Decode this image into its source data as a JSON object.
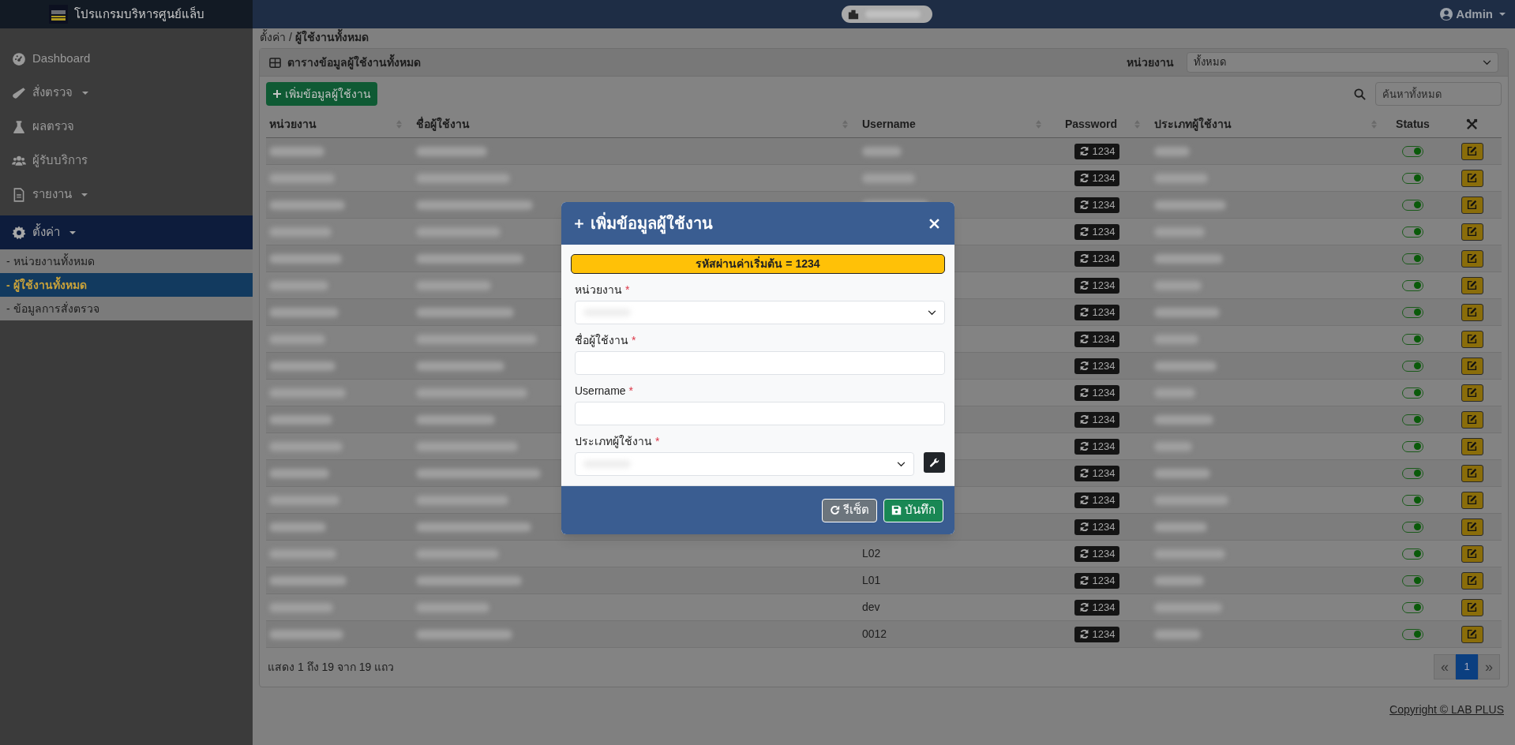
{
  "app": {
    "title": "โปรแกรมบริหารศูนย์แล็บ",
    "user": "Admin"
  },
  "sidebar": {
    "items": [
      {
        "label": "Dashboard",
        "selected": false,
        "dropdown": false
      },
      {
        "label": "สั่งตรวจ",
        "selected": false,
        "dropdown": true
      },
      {
        "label": "ผลตรวจ",
        "selected": false,
        "dropdown": false
      },
      {
        "label": "ผู้รับบริการ",
        "selected": false,
        "dropdown": false
      },
      {
        "label": "รายงาน",
        "selected": false,
        "dropdown": true
      },
      {
        "label": "ตั้งค่า",
        "selected": true,
        "dropdown": true,
        "children": [
          {
            "label": "- หน่วยงานทั้งหมด",
            "selected": false
          },
          {
            "label": "- ผู้ใช้งานทั้งหมด",
            "selected": true
          },
          {
            "label": "- ข้อมูลการสั่งตรวจ",
            "selected": false
          }
        ]
      }
    ]
  },
  "breadcrumb": [
    "ตั้งค่า /",
    "ผู้ใช้งานทั้งหมด"
  ],
  "card": {
    "title": "ตารางข้อมูลผู้ใช้งานทั้งหมด",
    "filter_label": "หน่วยงาน",
    "filter_value": "ทั้งหมด",
    "add_button": "เพิ่มข้อมูลผู้ใช้งาน",
    "search": {
      "placeholder": "ค้นหาทั้งหมด"
    }
  },
  "table": {
    "columns": [
      "หน่วยงาน",
      "ชื่อผู้ใช้งาน",
      "Username",
      "Password",
      "ประเภทผู้ใช้งาน",
      "Status"
    ],
    "rows": [
      {
        "password": "1234",
        "on": true
      },
      {
        "password": "1234",
        "on": true
      },
      {
        "password": "1234",
        "on": true
      },
      {
        "password": "1234",
        "on": true
      },
      {
        "password": "1234",
        "on": true
      },
      {
        "password": "1234",
        "on": true
      },
      {
        "password": "1234",
        "on": true
      },
      {
        "password": "1234",
        "on": true
      },
      {
        "password": "1234",
        "on": true
      },
      {
        "password": "1234",
        "on": true
      },
      {
        "password": "1234",
        "on": true
      },
      {
        "password": "1234",
        "on": true
      },
      {
        "password": "1234",
        "on": true
      },
      {
        "password": "1234",
        "on": true
      },
      {
        "password": "1234",
        "on": true
      },
      {
        "username": "L02",
        "password": "1234",
        "on": true
      },
      {
        "username": "L01",
        "password": "1234",
        "on": true
      },
      {
        "username": "dev",
        "password": "1234",
        "on": true
      },
      {
        "username": "0012",
        "password": "1234",
        "on": true
      }
    ]
  },
  "table_info": "แสดง 1 ถึง 19 จาก 19 แถว",
  "pagination": {
    "first": "«",
    "pages": [
      {
        "label": "1",
        "selected": true
      }
    ],
    "last": "»"
  },
  "footer": "Copyright © LAB PLUS",
  "modal": {
    "title": "เพิ่มข้อมูลผู้ใช้งาน",
    "alert": "รหัสผ่านค่าเริ่มต้น = 1234",
    "fields": [
      {
        "label": "หน่วยงาน",
        "kind": "select",
        "required_mark": "*"
      },
      {
        "label": "ชื่อผู้ใช้งาน",
        "kind": "text",
        "required_mark": "*"
      },
      {
        "label": "Username",
        "kind": "text",
        "required_mark": "*"
      },
      {
        "label": "ประเภทผู้ใช้งาน",
        "kind": "select_tool",
        "required_mark": "*"
      }
    ],
    "buttons": [
      {
        "label": "รีเซ็ต",
        "kind": "reset"
      },
      {
        "label": "บันทึก",
        "kind": "save"
      }
    ]
  }
}
